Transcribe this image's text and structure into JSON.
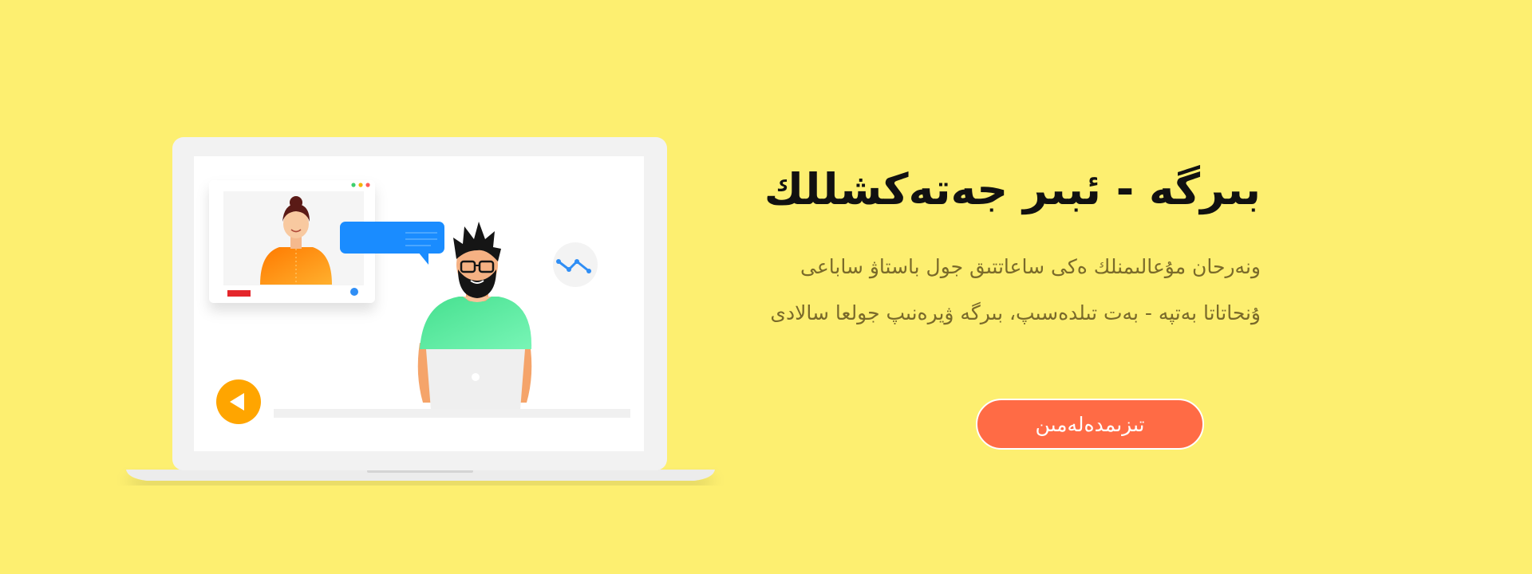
{
  "hero": {
    "title": "بىرگە - ئبىر جەتەكشللك",
    "description_lines": [
      "ونەرحان مۇعالىمنلك ەكى ساعاتتىق جول باستاۋ ساباعى",
      "ۇنحاتاتا بەتپە - بەت تىلدەسىپ، بىرگە ۋيرەنىپ جولعا سالادى"
    ],
    "cta_label": "تىزىمدەلەمىن"
  },
  "colors": {
    "background": "#fdef70",
    "cta": "#ff6b45",
    "title": "#111111",
    "description": "#7a6a2a"
  },
  "illustration": {
    "icons": [
      "laptop-icon",
      "teacher-avatar-icon",
      "chat-bubble-icon",
      "chart-icon",
      "play-button-icon"
    ]
  }
}
